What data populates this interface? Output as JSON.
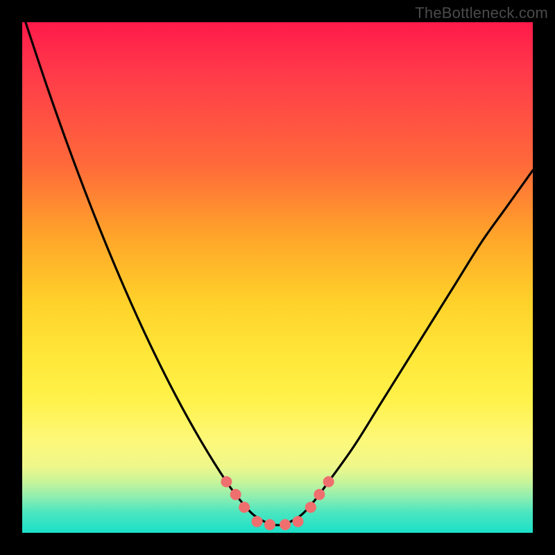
{
  "watermark": "TheBottleneck.com",
  "chart_data": {
    "type": "line",
    "title": "",
    "xlabel": "",
    "ylabel": "",
    "xlim": [
      0,
      100
    ],
    "ylim": [
      0,
      100
    ],
    "background_gradient": {
      "top": "#ff1a4a",
      "mid": "#ffe83a",
      "bottom": "#1be0c8"
    },
    "series": [
      {
        "name": "curve",
        "color": "#000000",
        "x": [
          0,
          5,
          10,
          15,
          20,
          25,
          30,
          35,
          40,
          43,
          46,
          50,
          54,
          57,
          60,
          65,
          70,
          75,
          80,
          85,
          90,
          95,
          100
        ],
        "y": [
          102,
          87,
          73,
          60,
          48,
          37,
          27,
          18,
          10,
          6,
          3,
          1.5,
          3,
          6,
          10,
          17,
          25,
          33,
          41,
          49,
          57,
          64,
          71
        ]
      }
    ],
    "markers": {
      "name": "trough-markers",
      "color": "#ef6f6e",
      "radius_px": 8,
      "points": [
        {
          "x": 40.0,
          "y": 10.0
        },
        {
          "x": 41.8,
          "y": 7.5
        },
        {
          "x": 43.5,
          "y": 5.0
        },
        {
          "x": 46.0,
          "y": 2.2
        },
        {
          "x": 48.5,
          "y": 1.6
        },
        {
          "x": 51.5,
          "y": 1.6
        },
        {
          "x": 54.0,
          "y": 2.2
        },
        {
          "x": 56.5,
          "y": 5.0
        },
        {
          "x": 58.2,
          "y": 7.5
        },
        {
          "x": 60.0,
          "y": 10.0
        }
      ]
    }
  }
}
